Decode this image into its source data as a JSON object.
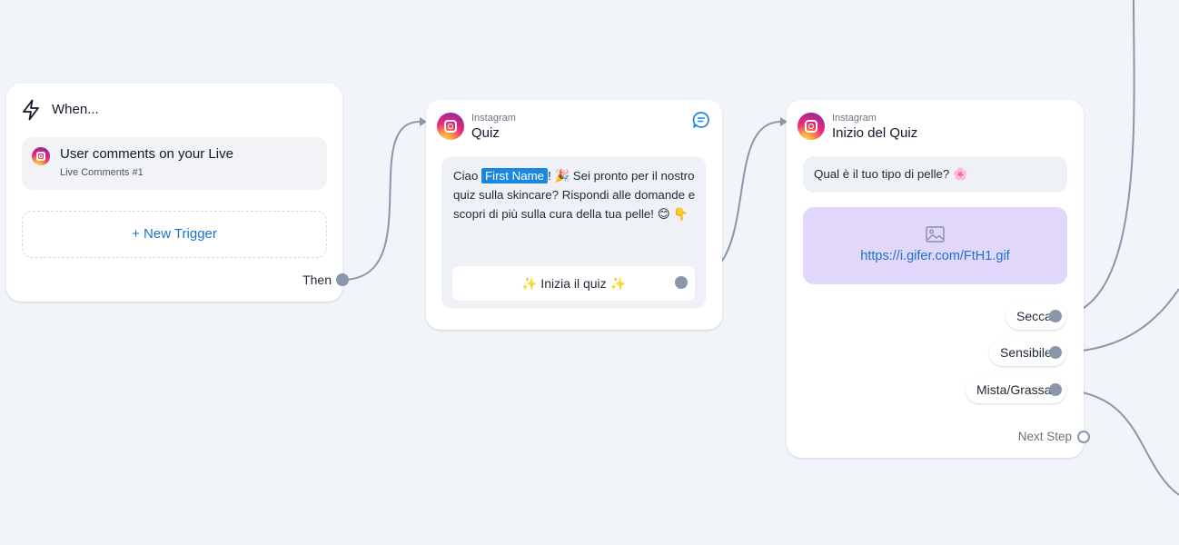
{
  "trigger_node": {
    "header": "When...",
    "trigger_title": "User comments on your Live",
    "trigger_subtitle": "Live Comments #1",
    "new_trigger_label": "+ New Trigger",
    "then_label": "Then"
  },
  "quiz_node": {
    "platform": "Instagram",
    "title": "Quiz",
    "message": {
      "pre": "Ciao ",
      "variable": "First Name",
      "post": "! 🎉 Sei pronto per il nostro quiz sulla skincare? Rispondi alle domande e scopri di più sulla cura della tua pelle! 😊 👇"
    },
    "button_label": "✨ Inizia il quiz ✨"
  },
  "start_node": {
    "platform": "Instagram",
    "title": "Inizio del Quiz",
    "question": "Qual è il tuo tipo di pelle? 🌸",
    "image_url": "https://i.gifer.com/FtH1.gif",
    "options": [
      "Secca",
      "Sensibile",
      "Mista/Grassa"
    ],
    "next_step_label": "Next Step"
  },
  "colors": {
    "canvas": "#f1f4f8",
    "link": "#1a73c8",
    "variable_highlight": "#1a88e0",
    "image_placeholder": "#e0d7fa",
    "connector": "#8a97ab"
  }
}
